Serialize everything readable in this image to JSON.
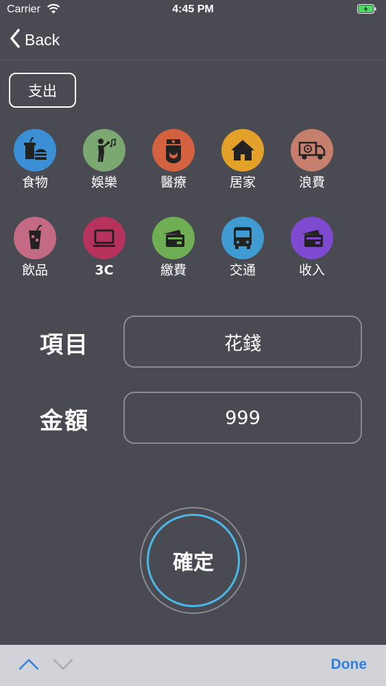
{
  "status": {
    "carrier": "Carrier",
    "time": "4:45 PM"
  },
  "nav": {
    "back_label": "Back"
  },
  "type_toggle": {
    "label": "支出"
  },
  "categories": [
    {
      "label": "食物",
      "color": "#3b8fd4",
      "icon": "fast-food-icon"
    },
    {
      "label": "娛樂",
      "color": "#7aa870",
      "icon": "singer-icon"
    },
    {
      "label": "醫療",
      "color": "#d4613f",
      "icon": "nurse-icon"
    },
    {
      "label": "居家",
      "color": "#e4a12a",
      "icon": "house-icon"
    },
    {
      "label": "浪費",
      "color": "#c67f6c",
      "icon": "truck-icon"
    },
    {
      "label": "飲品",
      "color": "#c46a85",
      "icon": "drink-icon"
    },
    {
      "label": "3C",
      "color": "#b8325e",
      "icon": "laptop-icon"
    },
    {
      "label": "繳費",
      "color": "#6fae54",
      "icon": "card-icon"
    },
    {
      "label": "交通",
      "color": "#3f9bd1",
      "icon": "bus-icon"
    },
    {
      "label": "收入",
      "color": "#7d4ad0",
      "icon": "card-icon"
    }
  ],
  "form": {
    "item_label": "項目",
    "item_value": "花錢",
    "amount_label": "金額",
    "amount_value": "999"
  },
  "confirm": {
    "label": "確定"
  },
  "keyboard_toolbar": {
    "done_label": "Done"
  }
}
